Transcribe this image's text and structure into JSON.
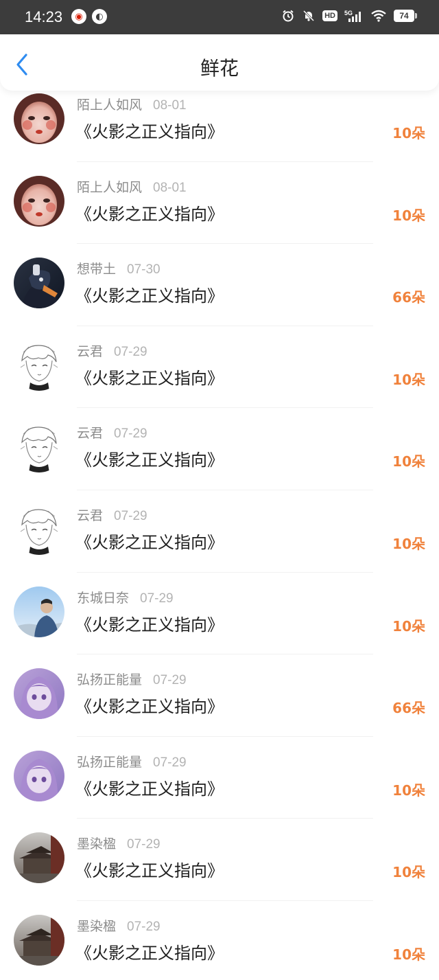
{
  "status_bar": {
    "time": "14:23",
    "network": "5G",
    "hd": "HD",
    "battery": "74"
  },
  "header": {
    "title": "鲜花"
  },
  "colors": {
    "accent_blue": "#2f8cf0",
    "amount_orange": "#f0823c"
  },
  "items": [
    {
      "name": "陌上人如风",
      "date": "08-01",
      "work": "《火影之正义指向》",
      "amount": "10朵",
      "avatar": "avatar-red-face"
    },
    {
      "name": "陌上人如风",
      "date": "08-01",
      "work": "《火影之正义指向》",
      "amount": "10朵",
      "avatar": "avatar-red-face"
    },
    {
      "name": "想带土",
      "date": "07-30",
      "work": "《火影之正义指向》",
      "amount": "66朵",
      "avatar": "avatar-dark-anime"
    },
    {
      "name": "云君",
      "date": "07-29",
      "work": "《火影之正义指向》",
      "amount": "10朵",
      "avatar": "avatar-sketch"
    },
    {
      "name": "云君",
      "date": "07-29",
      "work": "《火影之正义指向》",
      "amount": "10朵",
      "avatar": "avatar-sketch"
    },
    {
      "name": "云君",
      "date": "07-29",
      "work": "《火影之正义指向》",
      "amount": "10朵",
      "avatar": "avatar-sketch"
    },
    {
      "name": "东城日奈",
      "date": "07-29",
      "work": "《火影之正义指向》",
      "amount": "10朵",
      "avatar": "avatar-sky-photo"
    },
    {
      "name": "弘扬正能量",
      "date": "07-29",
      "work": "《火影之正义指向》",
      "amount": "66朵",
      "avatar": "avatar-purple-anime"
    },
    {
      "name": "弘扬正能量",
      "date": "07-29",
      "work": "《火影之正义指向》",
      "amount": "10朵",
      "avatar": "avatar-purple-anime"
    },
    {
      "name": "墨染楹",
      "date": "07-29",
      "work": "《火影之正义指向》",
      "amount": "10朵",
      "avatar": "avatar-temple"
    },
    {
      "name": "墨染楹",
      "date": "07-29",
      "work": "《火影之正义指向》",
      "amount": "10朵",
      "avatar": "avatar-temple"
    }
  ]
}
